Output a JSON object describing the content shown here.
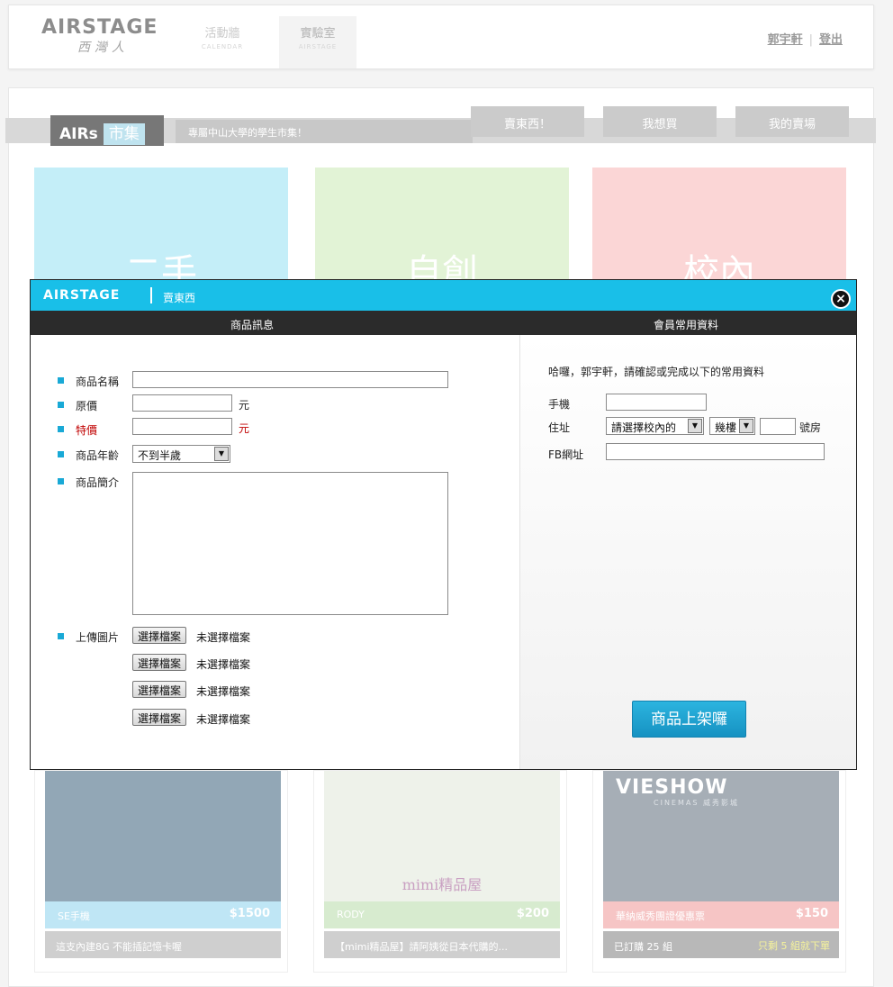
{
  "header": {
    "logo_text": "AIRSTAGE",
    "logo_sub": "西灣人",
    "nav": [
      {
        "label": "活動牆",
        "sub": "CALENDAR"
      },
      {
        "label": "實驗室",
        "sub": "AIRSTAGE"
      }
    ],
    "user_name": "郭宇軒",
    "separator": "|",
    "logout": "登出"
  },
  "market": {
    "logo_text": "AIRs",
    "logo_cn": "市集",
    "slogan": "專屬中山大學的學生市集！",
    "tabs": [
      "賣東西！",
      "我想買",
      "我的賣場"
    ],
    "categories": [
      "二手",
      "自創",
      "校內"
    ]
  },
  "products": [
    {
      "name": "SE手機",
      "price": "$1500",
      "desc": "這支內建8G 不能插記憶卡喔",
      "note": ""
    },
    {
      "name": "RODY",
      "price": "$200",
      "desc": "【mimi精品屋】請阿姨從日本代購的...",
      "note": "",
      "caption": "mimi精品屋"
    },
    {
      "name": "華納威秀團證優惠票",
      "price": "$150",
      "desc": "已訂購 25 組",
      "note": "只剩 5 組就下單",
      "brand": "VIESHOW",
      "brand_sub": "CINEMAS 威秀影城"
    }
  ],
  "modal": {
    "logo_text": "AIRSTAGE",
    "title": "賣東西",
    "close_icon": "close-icon",
    "tab_left": "商品訊息",
    "tab_right": "會員常用資料",
    "fields": {
      "name_label": "商品名稱",
      "orig_price_label": "原價",
      "special_price_label": "特價",
      "currency": "元",
      "age_label": "商品年齡",
      "age_value": "不到半歲",
      "intro_label": "商品簡介",
      "upload_label": "上傳圖片",
      "file_button": "選擇檔案",
      "file_status": "未選擇檔案"
    },
    "member": {
      "greeting": "哈囉，郭宇軒，請確認或完成以下的常用資料",
      "phone_label": "手機",
      "address_label": "住址",
      "dorm_select": "請選擇校內的",
      "floor_select": "幾樓",
      "room_suffix": "號房",
      "fb_label": "FB網址"
    },
    "submit_label": "商品上架囉"
  }
}
